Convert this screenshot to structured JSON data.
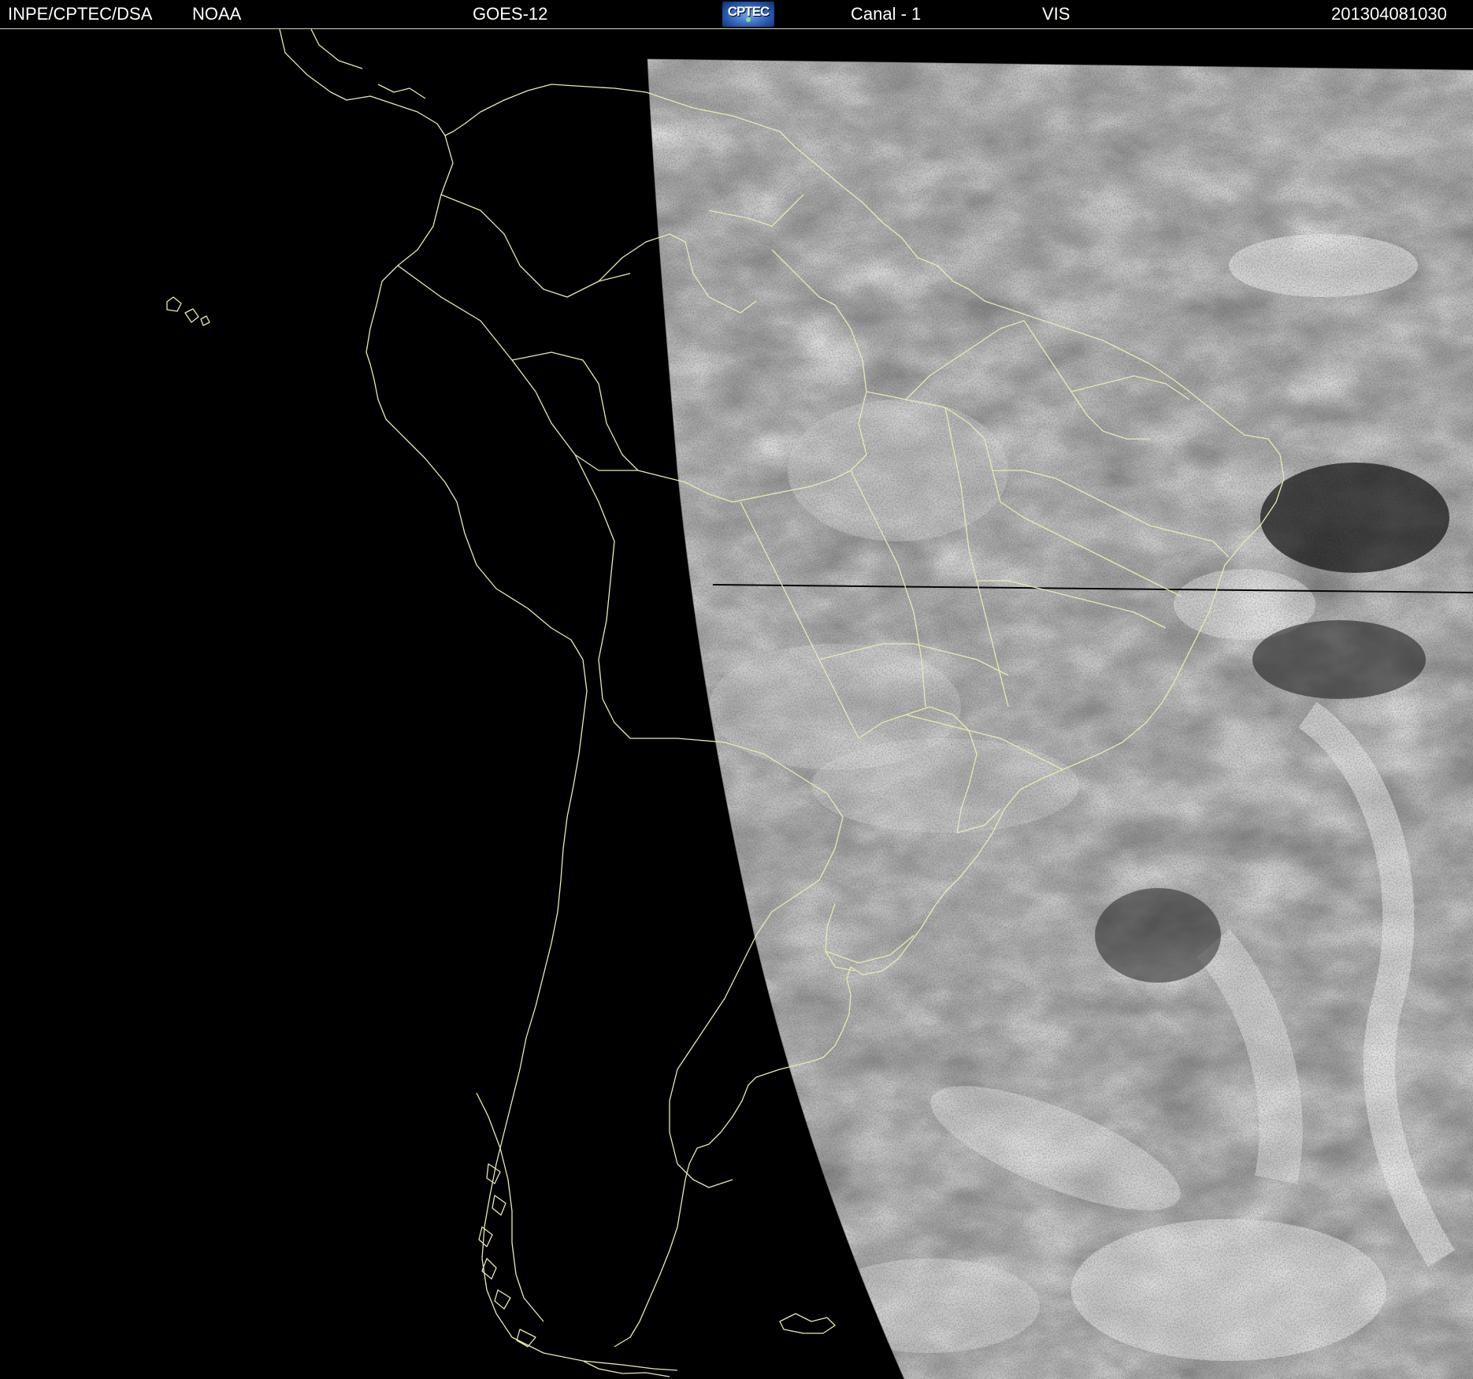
{
  "header": {
    "agency": "INPE/CPTEC/DSA",
    "provider": "NOAA",
    "satellite": "GOES-12",
    "logo_text": "CPTEC",
    "channel": "Canal - 1",
    "band": "VIS",
    "timestamp": "201304081030"
  },
  "colors": {
    "background": "#000000",
    "coastline": "#e9e9b0",
    "header_text": "#ffffff",
    "clouds": "#d9d9d9",
    "ocean_imagery": "#3a3a3a"
  },
  "map": {
    "region": "South America",
    "imagery": "visible satellite channel"
  }
}
